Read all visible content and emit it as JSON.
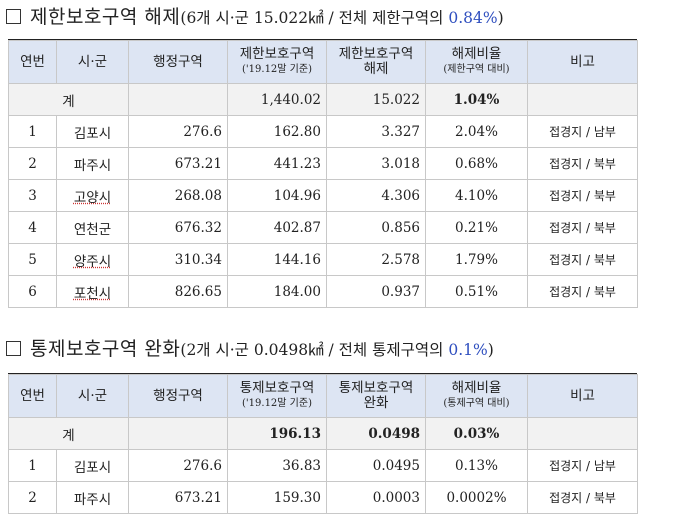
{
  "section1": {
    "title_main": "제한보호구역 해제",
    "title_sub": "(6개 시·군 15.022㎢ / 전체 제한구역의 ",
    "title_pct": "0.84%",
    "title_close": ")",
    "headers": {
      "seq": "연번",
      "city": "시·군",
      "admin_area": "행정구역",
      "zone_area": "제한보호구역",
      "zone_area_note": "('19.12말 기준)",
      "release": "제한보호구역",
      "release_line2": "해제",
      "ratio": "해제비율",
      "ratio_note": "(제한구역 대비)",
      "remark": "비고"
    },
    "total": {
      "label": "계",
      "zone_area": "1,440.02",
      "release": "15.022",
      "ratio": "1.04%"
    },
    "rows": [
      {
        "seq": "1",
        "city": "김포시",
        "admin_area": "276.6",
        "zone_area": "162.80",
        "release": "3.327",
        "ratio": "2.04%",
        "remark": "접경지 / 남부"
      },
      {
        "seq": "2",
        "city": "파주시",
        "admin_area": "673.21",
        "zone_area": "441.23",
        "release": "3.018",
        "ratio": "0.68%",
        "remark": "접경지 / 북부"
      },
      {
        "seq": "3",
        "city": "고양시",
        "admin_area": "268.08",
        "zone_area": "104.96",
        "release": "4.306",
        "ratio": "4.10%",
        "remark": "접경지 / 북부"
      },
      {
        "seq": "4",
        "city": "연천군",
        "admin_area": "676.32",
        "zone_area": "402.87",
        "release": "0.856",
        "ratio": "0.21%",
        "remark": "접경지 / 북부"
      },
      {
        "seq": "5",
        "city": "양주시",
        "admin_area": "310.34",
        "zone_area": "144.16",
        "release": "2.578",
        "ratio": "1.79%",
        "remark": "접경지 / 북부"
      },
      {
        "seq": "6",
        "city": "포천시",
        "admin_area": "826.65",
        "zone_area": "184.00",
        "release": "0.937",
        "ratio": "0.51%",
        "remark": "접경지 / 북부"
      }
    ]
  },
  "section2": {
    "title_main": "통제보호구역 완화",
    "title_sub": "(2개 시·군 0.0498㎢ / 전체 통제구역의 ",
    "title_pct": "0.1%",
    "title_close": ")",
    "headers": {
      "seq": "연번",
      "city": "시·군",
      "admin_area": "행정구역",
      "zone_area": "통제보호구역",
      "zone_area_note": "('19.12말 기준)",
      "release": "통제보호구역",
      "release_line2": "완화",
      "ratio": "해제비율",
      "ratio_note": "(통제구역 대비)",
      "remark": "비고"
    },
    "total": {
      "label": "계",
      "zone_area": "196.13",
      "release": "0.0498",
      "ratio": "0.03%"
    },
    "rows": [
      {
        "seq": "1",
        "city": "김포시",
        "admin_area": "276.6",
        "zone_area": "36.83",
        "release": "0.0495",
        "ratio": "0.13%",
        "remark": "접경지 / 남부"
      },
      {
        "seq": "2",
        "city": "파주시",
        "admin_area": "673.21",
        "zone_area": "159.30",
        "release": "0.0003",
        "ratio": "0.0002%",
        "remark": "접경지 / 북부"
      }
    ]
  }
}
